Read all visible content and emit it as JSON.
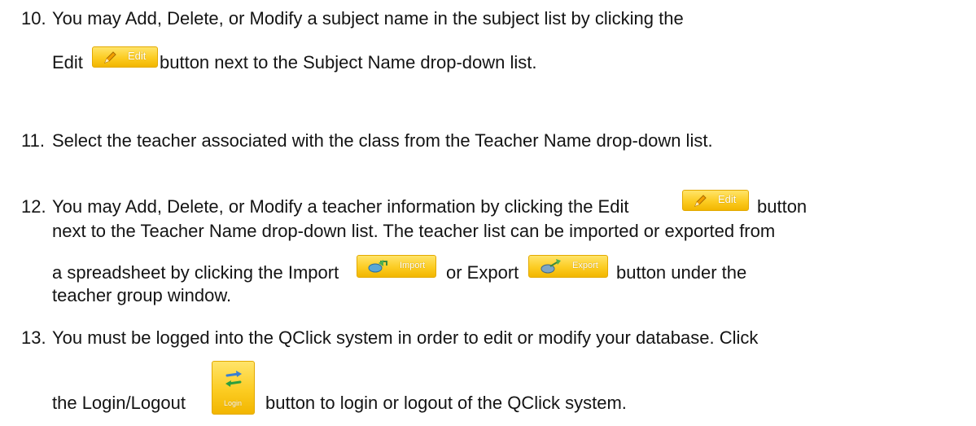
{
  "steps": [
    {
      "number": "10.",
      "line1": "You may Add, Delete, or Modify a subject name in the subject list by clicking the",
      "line2_pre": "Edit",
      "line2_post": "button next to the Subject Name drop-down list."
    },
    {
      "number": "11.",
      "line1": "Select the teacher associated with the class from the Teacher Name drop-down list."
    },
    {
      "number": "12.",
      "line1_pre": "You may Add, Delete, or Modify a teacher information by clicking the Edit",
      "line1_post": "button",
      "line2": "next to the Teacher Name drop-down list. The teacher list can be imported or exported from",
      "line3_pre": "a spreadsheet by clicking the Import",
      "line3_mid": "or Export",
      "line3_post": "button under the",
      "line4": "teacher group window."
    },
    {
      "number": "13.",
      "line1": "You must be logged into the QClick system in order to edit or modify your database. Click",
      "line2_pre": "the Login/Logout",
      "line2_post": "button to login or logout of the QClick system."
    }
  ],
  "buttons": {
    "edit": "Edit",
    "import": "Import",
    "export": "Export",
    "login": "Login"
  },
  "colors": {
    "button_fill": "#fccc22",
    "button_label": "#ffffff",
    "text": "#141414"
  },
  "icons": {
    "edit": "pencil-icon",
    "import": "import-icon",
    "export": "export-icon",
    "login": "swap-arrows-icon"
  }
}
